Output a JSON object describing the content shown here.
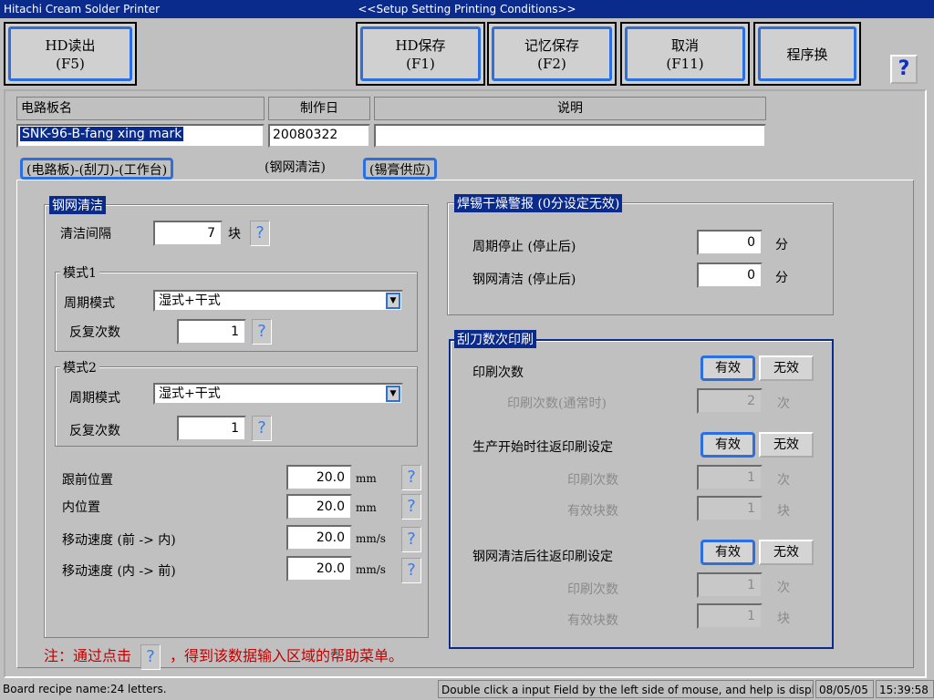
{
  "titlebar": {
    "app": "Hitachi Cream Solder Printer",
    "window": "<<Setup Setting Printing Conditions>>"
  },
  "toolbar": {
    "hd_read": [
      "HD读出",
      "(F5)"
    ],
    "hd_save": [
      "HD保存",
      "(F1)"
    ],
    "mem_save": [
      "记忆保存",
      "(F2)"
    ],
    "cancel": [
      "取消",
      "(F11)"
    ],
    "program": "程序换",
    "help": "?"
  },
  "header": {
    "board_name_label": "电路板名",
    "board_name": "SNK-96-B-fang xing mark",
    "date_label": "制作日",
    "date": "20080322",
    "desc_label": "说明",
    "desc": ""
  },
  "tabs": [
    "(电路板)-(刮刀)-(工作台)",
    "(钢网清洁)",
    "(锡膏供应)"
  ],
  "stencil": {
    "title": "钢网清洁",
    "interval_label": "清洁间隔",
    "interval": "7",
    "interval_unit": "块",
    "mode1_title": "模式1",
    "mode1_cycle_label": "周期模式",
    "mode1_cycle": "湿式+干式",
    "mode1_repeat_label": "反复次数",
    "mode1_repeat": "1",
    "mode2_title": "模式2",
    "mode2_cycle_label": "周期模式",
    "mode2_cycle": "湿式+干式",
    "mode2_repeat_label": "反复次数",
    "mode2_repeat": "1",
    "rows": [
      {
        "label": "跟前位置",
        "value": "20.0",
        "unit": "mm"
      },
      {
        "label": "内位置",
        "value": "20.0",
        "unit": "mm"
      },
      {
        "label": "移动速度 (前 -> 内)",
        "value": "20.0",
        "unit": "mm/s"
      },
      {
        "label": "移动速度 (内 -> 前)",
        "value": "20.0",
        "unit": "mm/s"
      }
    ]
  },
  "alarm": {
    "title": "焊锡干燥警报 (0分设定无效)",
    "stop_label": "周期停止 (停止后)",
    "stop": "0",
    "stop_unit": "分",
    "clean_label": "钢网清洁 (停止后)",
    "clean": "0",
    "clean_unit": "分"
  },
  "squeegee": {
    "title": "刮刀数次印刷",
    "on": "有效",
    "off": "无效",
    "print_count_label": "印刷次数",
    "normal_label": "印刷次数(通常时)",
    "normal": "2",
    "count_unit": "次",
    "start_label": "生产开始时往返印刷设定",
    "start_count_label": "印刷次数",
    "start_count": "1",
    "start_blocks_label": "有效块数",
    "start_blocks": "1",
    "block_unit": "块",
    "after_label": "钢网清洁后往返印刷设定",
    "after_count_label": "印刷次数",
    "after_count": "1",
    "after_blocks_label": "有效块数",
    "after_blocks": "1"
  },
  "note": {
    "prefix": "注：通过点击",
    "q": "?",
    "suffix": "，得到该数据输入区域的帮助菜单。"
  },
  "status": {
    "left": "Board recipe name:24 letters.",
    "hint": "Double click a input Field by the left side of mouse, and help is displayed.",
    "date": "08/05/05",
    "time": "15:39:58"
  }
}
